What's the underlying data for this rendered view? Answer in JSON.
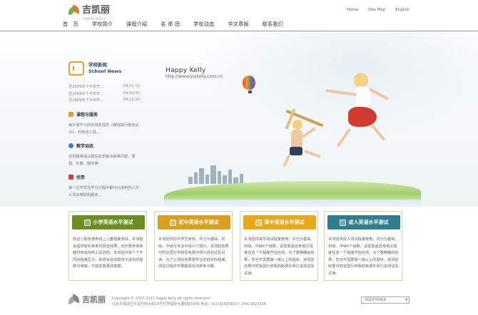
{
  "header": {
    "logo_text": "吉凯丽",
    "logo_sub": "HAPPY KELLY",
    "links": [
      "Home",
      "Site Map",
      "English"
    ],
    "nav": [
      "首　页",
      "学校简介",
      "课程介绍",
      "名 师 团",
      "学校动态",
      "华文章报",
      "联系我们"
    ]
  },
  "hero": {
    "title": "Happy Kelly",
    "url": "http://www.joykelly.com.cn"
  },
  "sidebar": {
    "news_title_cn": "学校新闻",
    "news_title_en": "School News",
    "news": [
      {
        "text": "至2009年下半年开...",
        "date": "09.01.13"
      },
      {
        "text": "至2009年下半年开...",
        "date": "09.01.05"
      },
      {
        "text": "至2009年下半年开...",
        "date": "08.12.16"
      }
    ],
    "sections": [
      {
        "title": "课程与服务",
        "text": "美外语学习的实效性理念《课程联问量身设计》、科技化工具...",
        "color": "#e0a030"
      },
      {
        "title": "教学动态",
        "text": "吉凯丽英语以帮佐初步解决辈难问题，课程、外教、服务等",
        "color": "#3a78c2"
      },
      {
        "title": "优势",
        "text": "每一位学员在学习过程中都可以得到自三方人员的帮助和服务...",
        "color": "#d04040"
      }
    ]
  },
  "cards": [
    {
      "title": "小学英语水平测试",
      "color": "#6b8e23",
      "text": "欢迎小朋友使用线上儿童程度测试，本测题会提供家长参考的报告结果，也不要参考库教材用其他的工具协助。本测验共有十个不同的程度区分，系统会自动帮孩子适当的题数与难度，不能能复更改答案。"
    },
    {
      "title": "初中英语水平测试",
      "color": "#d9a020",
      "text": "本测验供初中学生使用，共分为基础、初级、中级与专业中级六个部分，完测验结果可附全国分供我的免费外师口说测试及试读。为了让测验结果更符合您的实际程度，测验过程中不要翻阅任何参考书籍。"
    },
    {
      "title": "高中英语水平测试",
      "color": "#e8a81c",
      "text": "本测验供高中测试程度使用，共分为基础、初级、中级6个级数，请需靠适自身英文程度任选一个程度开始检测，为了更精确的结果，您也不需要做一级以上的题目。完测验结果可附全国分供我的免费外师口说测试及试读。"
    },
    {
      "title": "成人英语水平测试",
      "color": "#2f7d8f",
      "text": "本测验供成人测试程度使用，共分为基础、初级、中级6个级数，请需靠适自身英文程度任选一个程度开始检测，为了更精确的结果，您也不需要做一级以上的题目。完测验结果可附全国分供我的免费外师口说测试及试读。"
    }
  ],
  "footer": {
    "logo_text": "吉凯丽",
    "copyright": "Copyright © 2010-2011 happy kelly all rights reserved",
    "address": "北京市海淀区中关村南大街18号科学国际大厦B座1009  电话：010-82600820 / 18911623398",
    "select": "网站友情链接"
  }
}
